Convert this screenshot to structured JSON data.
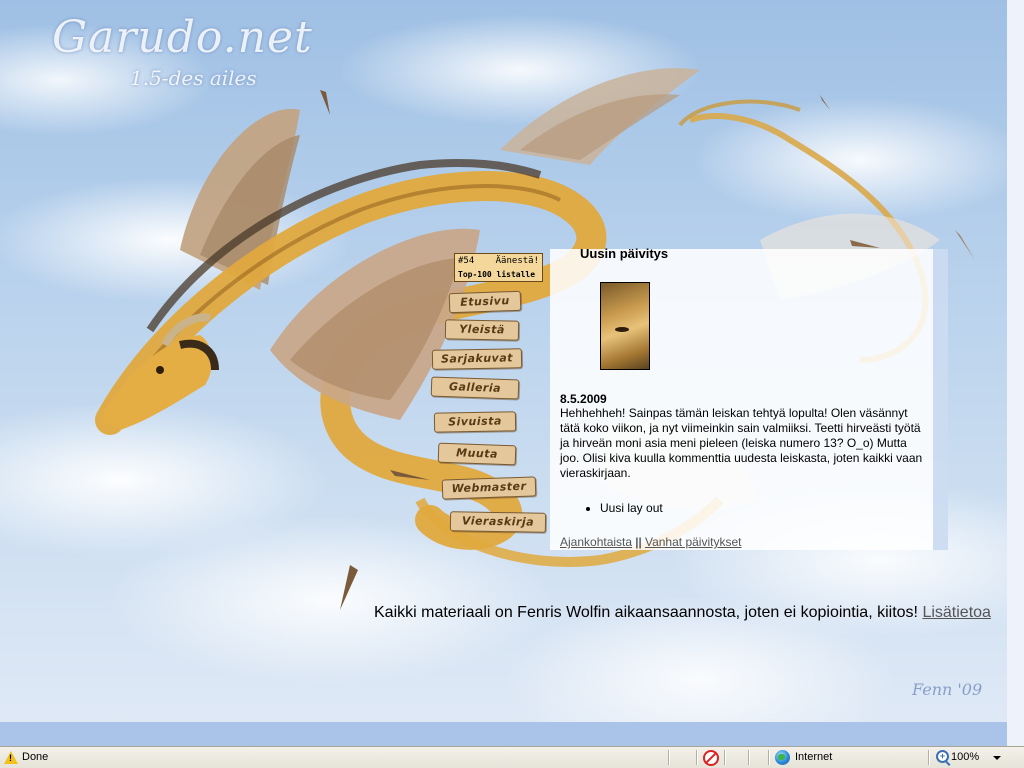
{
  "site": {
    "logo_text": "Garudo.net",
    "tagline": "1.5-des ailes",
    "signature": "Fenn '09"
  },
  "vote_badge": {
    "rank": "#54",
    "vote_label": "Äänestä!",
    "list_label": "Top-100 listalle"
  },
  "nav": {
    "items": [
      {
        "label": "Etusivu"
      },
      {
        "label": "Yleistä"
      },
      {
        "label": "Sarjakuvat"
      },
      {
        "label": "Galleria"
      },
      {
        "label": "Sivuista"
      },
      {
        "label": "Muuta"
      },
      {
        "label": "Webmaster"
      },
      {
        "label": "Vieraskirja"
      }
    ]
  },
  "update": {
    "heading": "Uusin päivitys",
    "date": "8.5.2009",
    "body": "Hehhehheh! Sainpas tämän leiskan tehtyä lopulta! Olen väsännyt tätä koko viikon, ja nyt viimeinkin sain valmiiksi. Teetti hirveästi työtä ja hirveän moni asia meni pieleen (leiska numero 13? O_o) Mutta joo. Olisi kiva kuulla kommenttia uudesta leiskasta, joten kaikki vaan vieraskirjaan.",
    "list": [
      "Uusi lay out"
    ],
    "link_news": "Ajankohtaista",
    "link_separator": "||",
    "link_old": "Vanhat päivitykset"
  },
  "footer": {
    "note": "Kaikki materiaali on Fenris Wolfin aikaansaannosta, joten ei kopiointia, kiitos!",
    "more_link": "Lisätietoa"
  },
  "status_bar": {
    "status_text": "Done",
    "zone_text": "Internet",
    "zoom_text": "100%"
  },
  "icons": {
    "status": "warning-icon",
    "popup_blocker": "popup-blocked-icon",
    "zone": "globe-icon",
    "zoom": "zoom-icon"
  },
  "colors": {
    "panel_bg": "#ffffff",
    "link": "#555555",
    "nav_sign": "#e4c79a",
    "sky": "#b6d0ec"
  }
}
